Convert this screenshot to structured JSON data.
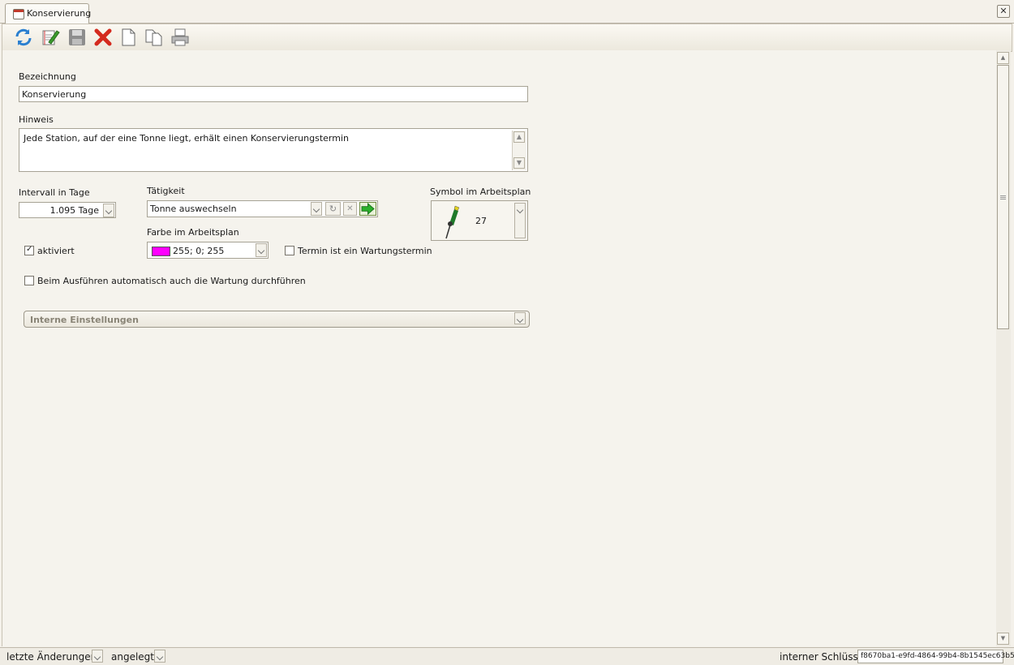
{
  "tab": {
    "label": "Konservierung"
  },
  "toolbar": {
    "buttons": [
      "refresh-icon",
      "edit-icon",
      "save-icon",
      "delete-icon",
      "new-document-icon",
      "copy-document-icon",
      "print-icon"
    ]
  },
  "form": {
    "bezeichnung": {
      "label": "Bezeichnung",
      "value": "Konservierung"
    },
    "hinweis": {
      "label": "Hinweis",
      "value": "Jede Station, auf der eine Tonne liegt, erhält einen Konservierungstermin"
    },
    "intervall": {
      "label": "Intervall in Tage",
      "value": "1.095 Tage"
    },
    "taetigkeit": {
      "label": "Tätigkeit",
      "value": "Tonne auswechseln"
    },
    "farbe": {
      "label": "Farbe im Arbeitsplan",
      "value": "255; 0; 255",
      "swatch": "#ff00ff"
    },
    "symbol": {
      "label": "Symbol im Arbeitsplan",
      "value": "27"
    },
    "aktiviert": {
      "label": "aktiviert",
      "checked": true
    },
    "wartungstermin": {
      "label": "Termin ist ein Wartungstermin",
      "checked": false
    },
    "auto_wartung": {
      "label": "Beim Ausführen automatisch auch die Wartung durchführen",
      "checked": false
    },
    "interne": {
      "label": "Interne Einstellungen"
    }
  },
  "status": {
    "letzte_label": "letzte Änderungen",
    "angelegt_label": "angelegt",
    "key_label": "interner Schlüssel",
    "key_value": "f8670ba1-e9fd-4864-99b4-8b1545ec63b5"
  }
}
